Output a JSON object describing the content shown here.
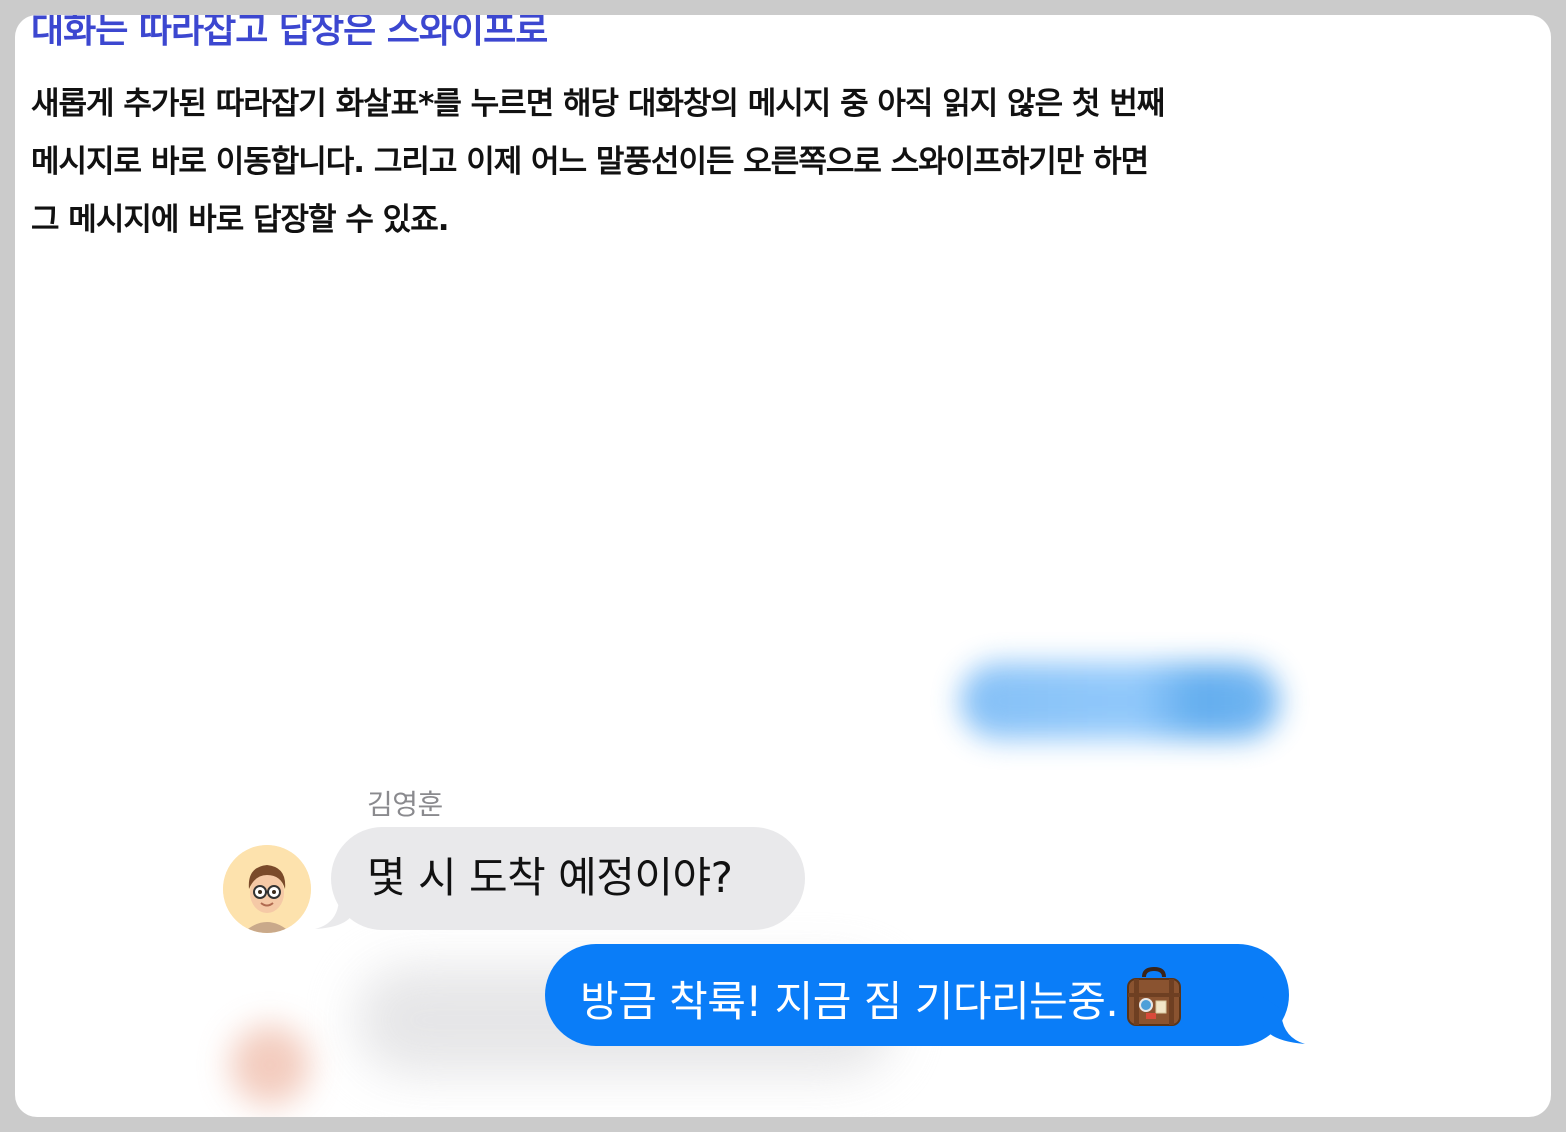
{
  "article": {
    "headline": "대화는 따라잡고 답장은 스와이프로",
    "body_lines": [
      "새롭게 추가된 따라잡기 화살표*를 누르면 해당 대화창의 메시지 중 아직 읽지 않은 첫 번째",
      "메시지로 바로 이동합니다. 그리고 이제 어느 말풍선이든 오른쪽으로 스와이프하기만 하면",
      "그 메시지에 바로 답장할 수 있죠."
    ]
  },
  "conversation": {
    "incoming": {
      "sender_name": "김영훈",
      "avatar_icon": "memoji-avatar-with-glasses",
      "text": "몇 시 도착 예정이야?"
    },
    "outgoing": {
      "text": "방금 착륙! 지금 짐 기다리는중.",
      "emoji_icon": "suitcase-icon"
    }
  },
  "colors": {
    "headline": "#3c47d0",
    "incoming_bubble": "#e9e9eb",
    "outgoing_bubble": "#0a7df8",
    "sender_name": "#8a8a8e"
  }
}
